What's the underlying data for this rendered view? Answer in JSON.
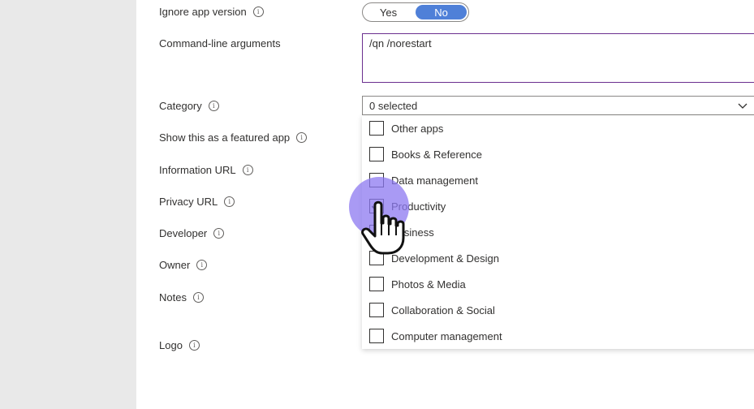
{
  "form": {
    "ignore_app_version": {
      "label": "Ignore app version",
      "options": [
        "Yes",
        "No"
      ],
      "selected": "No"
    },
    "command_line": {
      "label": "Command-line arguments",
      "value": "/qn /norestart"
    },
    "category": {
      "label": "Category",
      "value": "0 selected"
    },
    "featured": {
      "label": "Show this as a featured app"
    },
    "information_url": {
      "label": "Information URL"
    },
    "privacy_url": {
      "label": "Privacy URL"
    },
    "developer": {
      "label": "Developer"
    },
    "owner": {
      "label": "Owner"
    },
    "notes": {
      "label": "Notes"
    },
    "logo": {
      "label": "Logo"
    }
  },
  "category_options": [
    {
      "label": "Other apps",
      "checked": false
    },
    {
      "label": "Books & Reference",
      "checked": false
    },
    {
      "label": "Data management",
      "checked": false
    },
    {
      "label": "Productivity",
      "checked": true
    },
    {
      "label": "Business",
      "checked": false
    },
    {
      "label": "Development & Design",
      "checked": false
    },
    {
      "label": "Photos & Media",
      "checked": false
    },
    {
      "label": "Collaboration & Social",
      "checked": false
    },
    {
      "label": "Computer management",
      "checked": false
    }
  ],
  "info_icon_glyph": "i",
  "colors": {
    "toggle_selected": "#4f80d8",
    "textbox_border": "#6b2f8f",
    "click_indicator": "#8c78f0"
  }
}
